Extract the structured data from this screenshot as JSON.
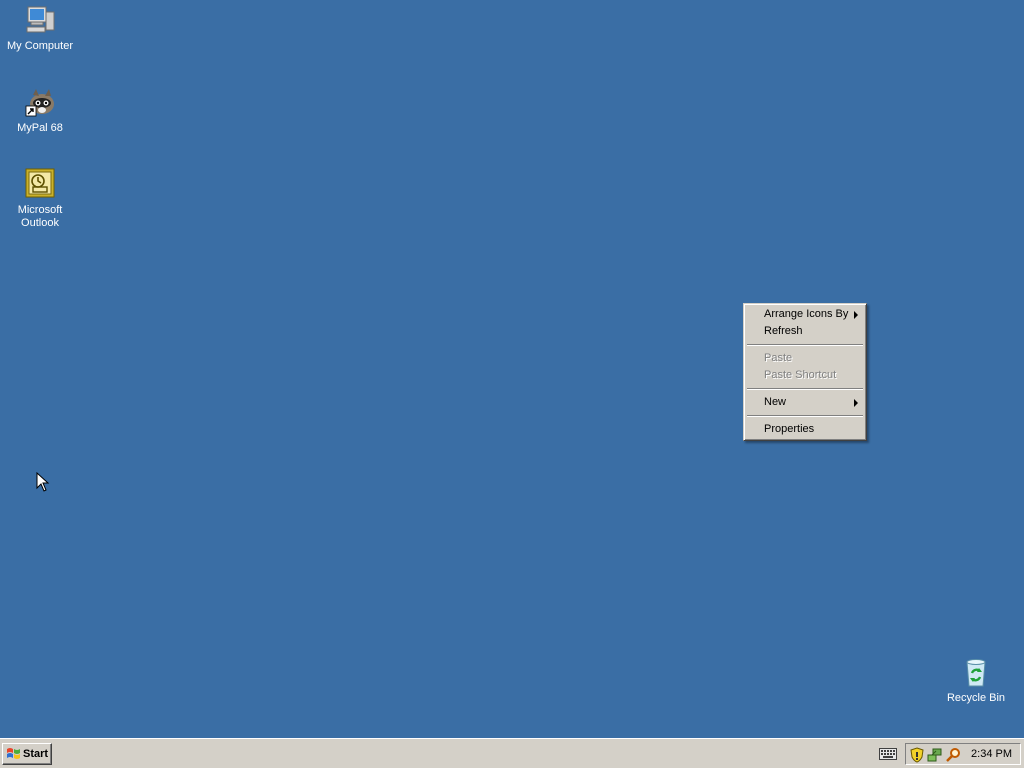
{
  "desktop": {
    "background_color": "#3a6ea5",
    "icons": [
      {
        "label": "My Computer",
        "icon": "my-computer-icon"
      },
      {
        "label": "MyPal 68",
        "icon": "mypal-raccoon-icon"
      },
      {
        "label": "Microsoft Outlook",
        "icon": "outlook-icon"
      },
      {
        "label": "Recycle Bin",
        "icon": "recycle-bin-icon"
      }
    ]
  },
  "context_menu": {
    "items": [
      {
        "label": "Arrange Icons By",
        "enabled": true,
        "submenu": true
      },
      {
        "label": "Refresh",
        "enabled": true,
        "submenu": false
      },
      {
        "label": "Paste",
        "enabled": false,
        "submenu": false
      },
      {
        "label": "Paste Shortcut",
        "enabled": false,
        "submenu": false
      },
      {
        "label": "New",
        "enabled": true,
        "submenu": true
      },
      {
        "label": "Properties",
        "enabled": true,
        "submenu": false
      }
    ]
  },
  "taskbar": {
    "start_label": "Start",
    "tray_icons": [
      "keyboard-icon",
      "security-shield-icon",
      "network-icon",
      "search-icon"
    ],
    "clock": "2:34 PM"
  }
}
